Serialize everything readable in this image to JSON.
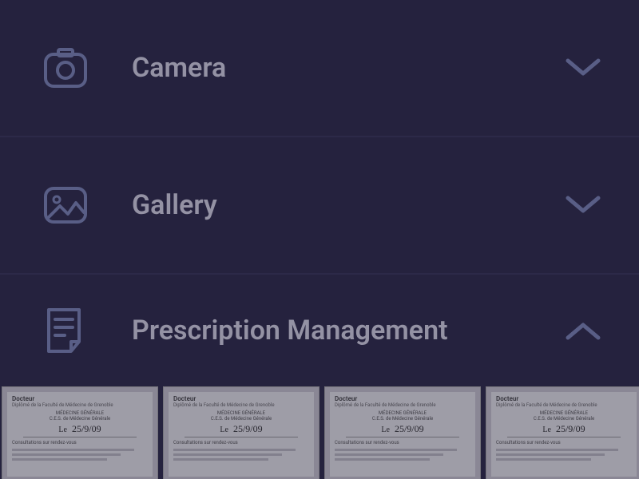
{
  "sections": {
    "camera": {
      "label": "Camera",
      "expanded": false
    },
    "gallery": {
      "label": "Gallery",
      "expanded": false
    },
    "prescription": {
      "label": "Prescription Management",
      "expanded": true
    }
  },
  "prescription_thumbs": [
    {
      "header": "Docteur",
      "date": "25/9/09"
    },
    {
      "header": "Docteur",
      "date": "25/9/09"
    },
    {
      "header": "Docteur",
      "date": "25/9/09"
    },
    {
      "header": "Docteur",
      "date": "25/9/09"
    }
  ],
  "colors": {
    "bg": "#2e2b4a",
    "icon": "#7e88b8",
    "text": "#d9d7e6"
  }
}
